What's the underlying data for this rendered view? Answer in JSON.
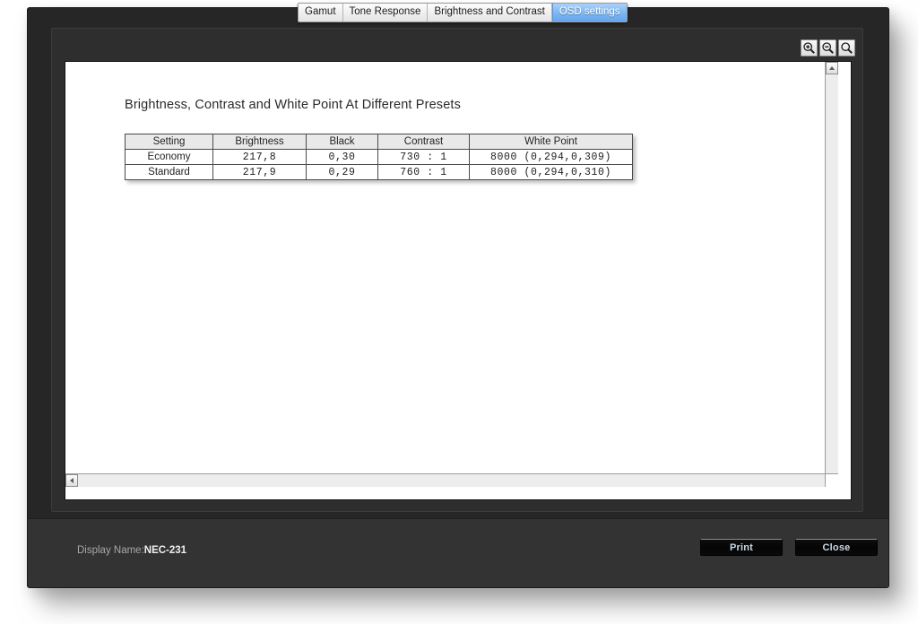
{
  "tabs": [
    {
      "label": "Gamut",
      "active": false
    },
    {
      "label": "Tone Response",
      "active": false
    },
    {
      "label": "Brightness and Contrast",
      "active": false
    },
    {
      "label": "OSD settings",
      "active": true
    }
  ],
  "toolbar": {
    "zoom_in": "zoom-in-icon",
    "zoom_out": "zoom-out-icon",
    "zoom_fit": "magnifier-icon"
  },
  "report": {
    "title": "Brightness, Contrast and White Point At Different Presets",
    "columns": [
      "Setting",
      "Brightness",
      "Black",
      "Contrast",
      "White Point"
    ],
    "rows": [
      {
        "setting": "Economy",
        "brightness": "217,8",
        "black": "0,30",
        "contrast": "730 : 1",
        "white_point": "8000  (0,294,0,309)"
      },
      {
        "setting": "Standard",
        "brightness": "217,9",
        "black": "0,29",
        "contrast": "760 : 1",
        "white_point": "8000  (0,294,0,310)"
      }
    ]
  },
  "status": {
    "display_name_label": "Display Name:",
    "display_name_value": "NEC-231"
  },
  "buttons": {
    "print": "Print",
    "close": "Close"
  },
  "colors": {
    "active_tab": "#7fb8f3",
    "window_bg": "#262626",
    "statusbar_bg": "#333333",
    "button_text": "#c9d9e6"
  }
}
